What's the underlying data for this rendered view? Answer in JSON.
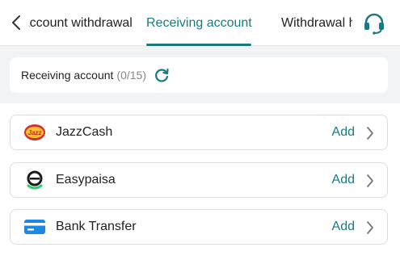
{
  "header": {
    "tabs": [
      {
        "label": "Account withdrawal",
        "active": false
      },
      {
        "label": "Receiving account",
        "active": true
      },
      {
        "label": "Withdrawal history",
        "active": false
      }
    ],
    "back_icon": "chevron-left-icon",
    "support_icon": "headset-icon"
  },
  "summary": {
    "label": "Receiving account",
    "count": "(0/15)",
    "refresh_icon": "refresh-icon"
  },
  "accounts": [
    {
      "name": "JazzCash",
      "action": "Add",
      "icon": "jazzcash-logo"
    },
    {
      "name": "Easypaisa",
      "action": "Add",
      "icon": "easypaisa-logo"
    },
    {
      "name": "Bank Transfer",
      "action": "Add",
      "icon": "bank-card-icon"
    }
  ],
  "colors": {
    "accent": "#1a7a80",
    "page_bg": "#f2f3f5",
    "bank_blue": "#1e88e5"
  }
}
